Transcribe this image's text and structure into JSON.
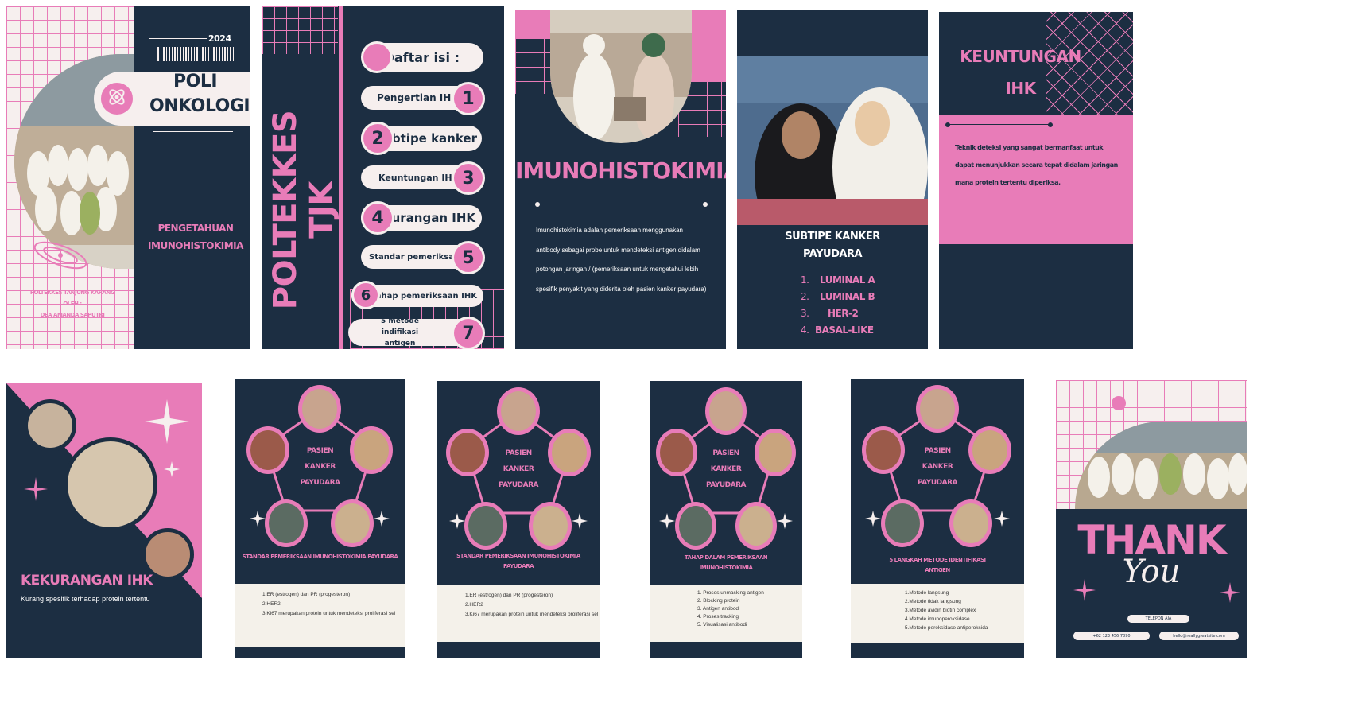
{
  "colors": {
    "navy": "#1c2e42",
    "pink": "#e87cb8",
    "cream": "#f6efee"
  },
  "slide1": {
    "year": "2024",
    "title_line1": "POLI",
    "title_line2": "ONKOLOGI",
    "subtitle_line1": "PENGETAHUAN",
    "subtitle_line2": "IMUNOHISTOKIMIA",
    "footer_line1": "POLTEKKES TANJUNG KARANG",
    "footer_line2": "OLEH :",
    "footer_line3": "DEA AMANDA SAPUTRI",
    "logo_icon": "atom-icon"
  },
  "slide2": {
    "vertical_title": "POLTEKKES TJK",
    "heading": "Daftar isi :",
    "items": [
      {
        "n": "1",
        "label": "Pengertian IHK"
      },
      {
        "n": "2",
        "label": "Subtipe kanker"
      },
      {
        "n": "3",
        "label": "Keuntungan IHK"
      },
      {
        "n": "4",
        "label": "Kekurangan IHK"
      },
      {
        "n": "5",
        "label": "Standar pemeriksaan"
      },
      {
        "n": "6",
        "label": "Tahap pemeriksaan IHK"
      },
      {
        "n": "7",
        "label": "5 metode indifikasi antigen"
      }
    ]
  },
  "slide3": {
    "title": "IMUNOHISTOKIMIA",
    "body": "Imunohistokimia adalah pemeriksaan menggunakan antibody sebagai probe untuk mendeteksi antigen didalam potongan jaringan / (pemeriksaan untuk mengetahui lebih spesifik penyakit yang diderita oleh pasien kanker payudara)"
  },
  "slide4": {
    "title_line1": "SUBTIPE KANKER",
    "title_line2": "PAYUDARA",
    "items": [
      "LUMINAL A",
      "LUMINAL B",
      "HER-2",
      "BASAL-LIKE"
    ]
  },
  "slide5": {
    "title_line1": "KEUNTUNGAN",
    "title_line2": "IHK",
    "body": "Teknik deteksi yang sangat bermanfaat untuk dapat menunjukkan secara tepat didalam jaringan mana protein tertentu diperiksa."
  },
  "slide6": {
    "title": "KEKURANGAN IHK",
    "body": "Kurang spesifik terhadap protein tertentu"
  },
  "slide7": {
    "center": [
      "PASIEN",
      "KANKER",
      "PAYUDARA"
    ],
    "heading": "STANDAR PEMERIKSAAN IMUNOHISTOKIMIA PAYUDARA",
    "items": [
      "1.ER (estrogen) dan PR (progesteron)",
      "2.HER2",
      "3.Ki67 merupakan protein untuk mendeteksi proliferasi sel"
    ]
  },
  "slide8": {
    "center": [
      "PASIEN",
      "KANKER",
      "PAYUDARA"
    ],
    "heading": "STANDAR PEMERIKSAAN IMUNOHISTOKIMIA PAYUDARA",
    "items": [
      "1.ER (estrogen) dan PR (progesteron)",
      "2.HER2",
      "3.Ki67 merupakan protein untuk mendeteksi proliferasi sel"
    ]
  },
  "slide9": {
    "center": [
      "PASIEN",
      "KANKER",
      "PAYUDARA"
    ],
    "heading": "TAHAP DALAM PEMERIKSAAN IMUNOHISTOKIMIA",
    "items": [
      "1. Proses unmasking antigen",
      "2. Blocking protein",
      "3. Antigen antibodi",
      "4. Proses tracking",
      "5. Visualisasi antibodi"
    ]
  },
  "slide10": {
    "center": [
      "PASIEN",
      "KANKER",
      "PAYUDARA"
    ],
    "heading": "5 LANGKAH METODE IDENTIFIKASI ANTIGEN",
    "items": [
      "1.Metode langsung",
      "2.Metode tidak langsung",
      "3.Metode avidin biotin complex",
      "4.Metode imunoperoksidase",
      "5.Metode peroksidase antiperoksida"
    ]
  },
  "slide11": {
    "title": "THANK",
    "script": "You",
    "contact_1": "TELEPON AJA",
    "contact_2": "+62 123 456 7890",
    "contact_3": "hello@reallygreatsite.com"
  }
}
